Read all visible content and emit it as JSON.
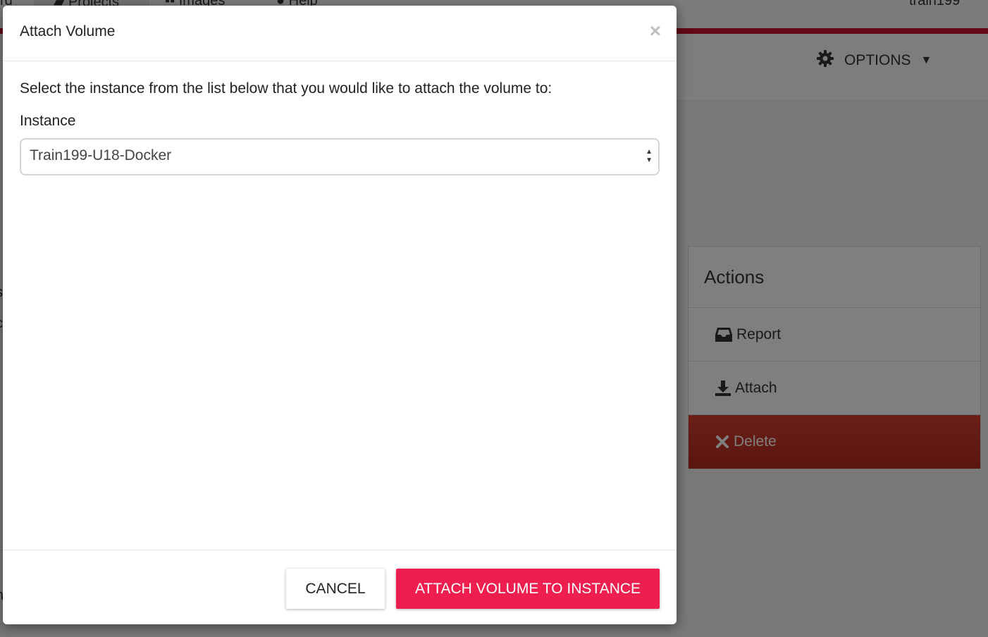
{
  "background": {
    "nav": {
      "items": [
        "rd",
        "Projects",
        "Images",
        "Help"
      ],
      "user": "train199"
    },
    "options_label": "OPTIONS",
    "actions": {
      "title": "Actions",
      "items": [
        {
          "label": "Report",
          "icon": "inbox-icon"
        },
        {
          "label": "Attach",
          "icon": "download-icon"
        },
        {
          "label": "Delete",
          "icon": "close-x-icon"
        }
      ]
    }
  },
  "modal": {
    "title": "Attach Volume",
    "close_glyph": "×",
    "description": "Select the instance from the list below that you would like to attach the volume to:",
    "instance_label": "Instance",
    "instance_selected": "Train199-U18-Docker",
    "cancel_label": "CANCEL",
    "attach_label": "ATTACH VOLUME TO INSTANCE"
  },
  "colors": {
    "accent_bar": "#c8102e",
    "primary_button": "#ee1f4f",
    "delete_action": "#c4352a",
    "overlay": "rgba(0,0,0,0.5)"
  }
}
